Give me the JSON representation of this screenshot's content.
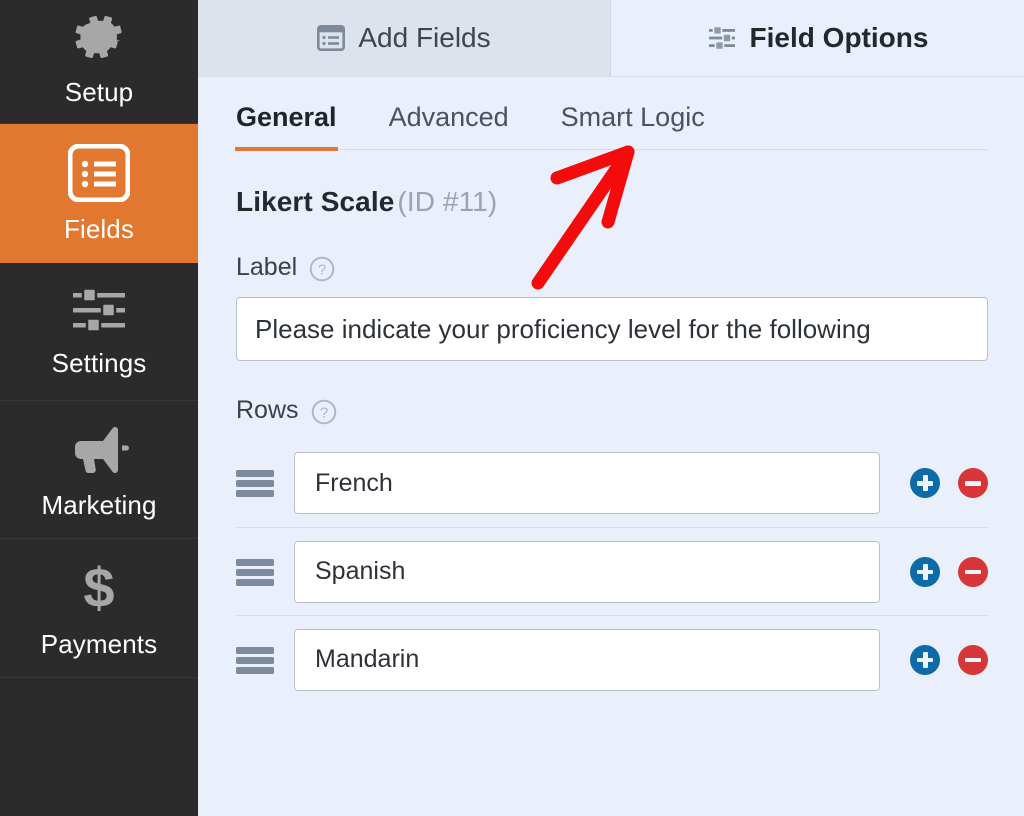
{
  "sidebar": {
    "items": [
      {
        "label": "Setup",
        "icon": "gear-icon",
        "active": false
      },
      {
        "label": "Fields",
        "icon": "list-icon",
        "active": true
      },
      {
        "label": "Settings",
        "icon": "sliders-icon",
        "active": false
      },
      {
        "label": "Marketing",
        "icon": "megaphone-icon",
        "active": false
      },
      {
        "label": "Payments",
        "icon": "dollar-icon",
        "active": false
      }
    ]
  },
  "top_tabs": [
    {
      "label": "Add Fields",
      "icon": "list-panel-icon",
      "active": false
    },
    {
      "label": "Field Options",
      "icon": "sliders-icon",
      "active": true
    }
  ],
  "sub_tabs": [
    {
      "label": "General",
      "active": true
    },
    {
      "label": "Advanced",
      "active": false
    },
    {
      "label": "Smart Logic",
      "active": false
    }
  ],
  "field": {
    "type_name": "Likert Scale",
    "id_text": "(ID #11)",
    "label_section": {
      "title": "Label",
      "help_icon": "question-circle-icon",
      "value": "Please indicate your proficiency level for the following"
    },
    "rows_section": {
      "title": "Rows",
      "help_icon": "question-circle-icon",
      "rows": [
        {
          "value": "French",
          "add_label": "+",
          "remove_label": "−"
        },
        {
          "value": "Spanish",
          "add_label": "+",
          "remove_label": "−"
        },
        {
          "value": "Mandarin",
          "add_label": "+",
          "remove_label": "−"
        }
      ]
    }
  },
  "annotation": {
    "shape": "red-arrow",
    "points_to": "Smart Logic",
    "color": "#f40b0b"
  },
  "colors": {
    "accent_orange": "#e27730",
    "sidebar_dark": "#2b2b2b",
    "panel_bg": "#e9effb",
    "inactive_tab_bg": "#dde3ec",
    "add_blue": "#0f6aa8",
    "remove_red": "#d63638"
  }
}
